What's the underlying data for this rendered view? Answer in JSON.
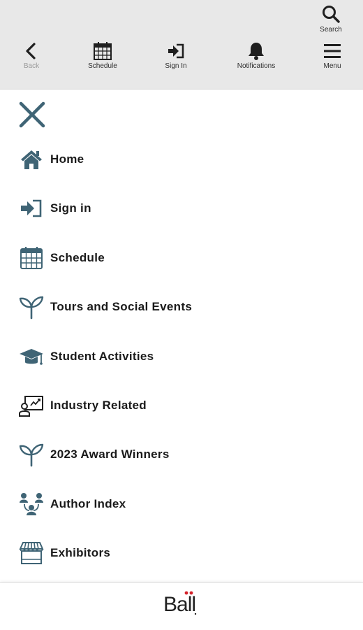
{
  "colors": {
    "icon": "#3f6475",
    "toolbar_bg": "#e8e8e8",
    "logo_dot": "#d4212a"
  },
  "toolbar": {
    "search_label": "Search",
    "back_label": "Back",
    "schedule_label": "Schedule",
    "signin_label": "Sign In",
    "notifications_label": "Notifications",
    "menu_label": "Menu"
  },
  "menu": {
    "close_icon": "close-icon",
    "items": [
      {
        "label": "Home",
        "icon": "home-icon"
      },
      {
        "label": "Sign in",
        "icon": "sign-in-icon"
      },
      {
        "label": "Schedule",
        "icon": "calendar-icon"
      },
      {
        "label": "Tours and Social Events",
        "icon": "sprout-icon"
      },
      {
        "label": "Student Activities",
        "icon": "graduation-cap-icon"
      },
      {
        "label": "Industry Related",
        "icon": "presentation-icon"
      },
      {
        "label": "2023 Award Winners",
        "icon": "sprout-icon"
      },
      {
        "label": "Author Index",
        "icon": "people-network-icon"
      },
      {
        "label": "Exhibitors",
        "icon": "storefront-icon"
      }
    ]
  },
  "footer": {
    "logo_text": "Ball"
  }
}
